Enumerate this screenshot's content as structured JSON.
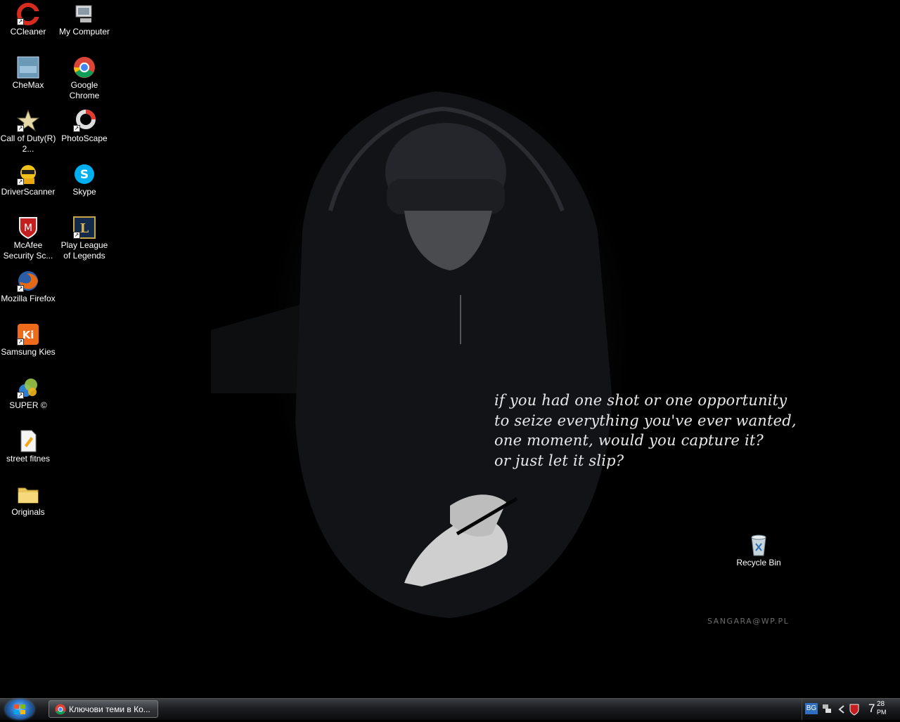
{
  "desktop": {
    "icons": [
      {
        "label": "CCleaner",
        "icon": "ccleaner-icon"
      },
      {
        "label": "My Computer",
        "icon": "computer-icon"
      },
      {
        "label": "CheMax",
        "icon": "chemax-icon"
      },
      {
        "label": "Google Chrome",
        "icon": "chrome-icon"
      },
      {
        "label": "Call of Duty(R) 2...",
        "icon": "cod-star-icon"
      },
      {
        "label": "PhotoScape",
        "icon": "photoscape-icon"
      },
      {
        "label": "DriverScanner",
        "icon": "driverscanner-icon"
      },
      {
        "label": "Skype",
        "icon": "skype-icon"
      },
      {
        "label": "McAfee Security Sc...",
        "icon": "mcafee-icon"
      },
      {
        "label": "Play League of Legends",
        "icon": "league-icon"
      },
      {
        "label": "Mozilla Firefox",
        "icon": "firefox-icon"
      },
      {
        "label": "Samsung Kies",
        "icon": "kies-icon"
      },
      {
        "label": "SUPER ©",
        "icon": "super-icon"
      },
      {
        "label": "street fitnes",
        "icon": "document-icon"
      },
      {
        "label": "Originals",
        "icon": "folder-icon"
      },
      {
        "label": "Recycle Bin",
        "icon": "recycle-bin-icon"
      }
    ]
  },
  "wallpaper": {
    "quote_lines": [
      "if you had one shot or one opportunity",
      "to seize everything you've ever wanted,",
      "one moment, would you capture it?",
      "or just let it slip?"
    ],
    "watermark": "SANGARA@WP.PL"
  },
  "taskbar": {
    "task_label": "Ключови теми в Ко...",
    "language": "BG",
    "clock_hour": "7",
    "clock_minutes": "28",
    "clock_ampm": "PM"
  }
}
